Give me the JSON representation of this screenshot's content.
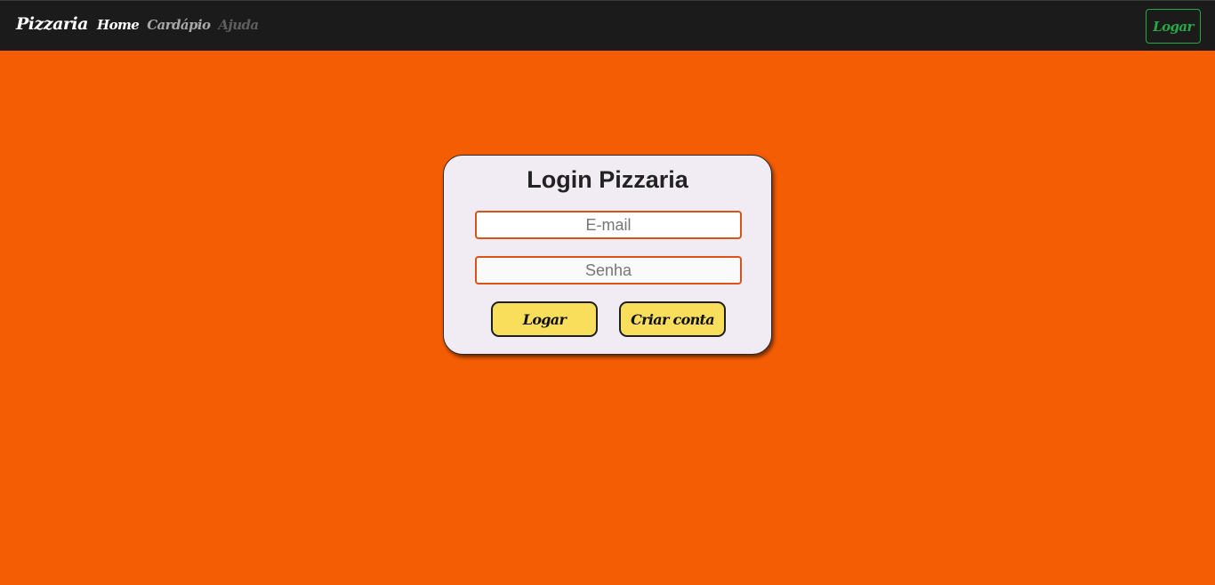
{
  "navbar": {
    "brand": "Pizzaria",
    "links": [
      {
        "label": "Home",
        "state": "active"
      },
      {
        "label": "Cardápio",
        "state": "normal"
      },
      {
        "label": "Ajuda",
        "state": "disabled"
      }
    ],
    "login_button": "Logar"
  },
  "login_form": {
    "title": "Login Pizzaria",
    "email_placeholder": "E-mail",
    "password_placeholder": "Senha",
    "login_button": "Logar",
    "signup_button": "Criar conta"
  },
  "colors": {
    "background": "#f45d04",
    "navbar": "#1b1b1b",
    "accent_green": "#28a745",
    "button_yellow": "#f9de5c",
    "card": "#f1ecf4"
  }
}
